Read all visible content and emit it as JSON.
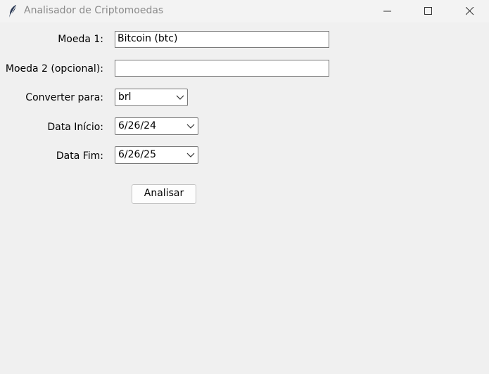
{
  "window": {
    "title": "Analisador de Criptomoedas"
  },
  "form": {
    "moeda1_label": "Moeda 1:",
    "moeda1_value": "Bitcoin (btc)",
    "moeda2_label": "Moeda 2 (opcional):",
    "moeda2_value": "",
    "converter_label": "Converter para:",
    "converter_value": "brl",
    "data_inicio_label": "Data Início:",
    "data_inicio_value": "6/26/24",
    "data_fim_label": "Data Fim:",
    "data_fim_value": "6/26/25",
    "analisar_label": "Analisar"
  },
  "icons": {
    "app": "feather-icon",
    "minimize": "minimize-icon",
    "maximize": "maximize-icon",
    "close": "close-icon",
    "dropdown": "chevron-down-icon"
  }
}
